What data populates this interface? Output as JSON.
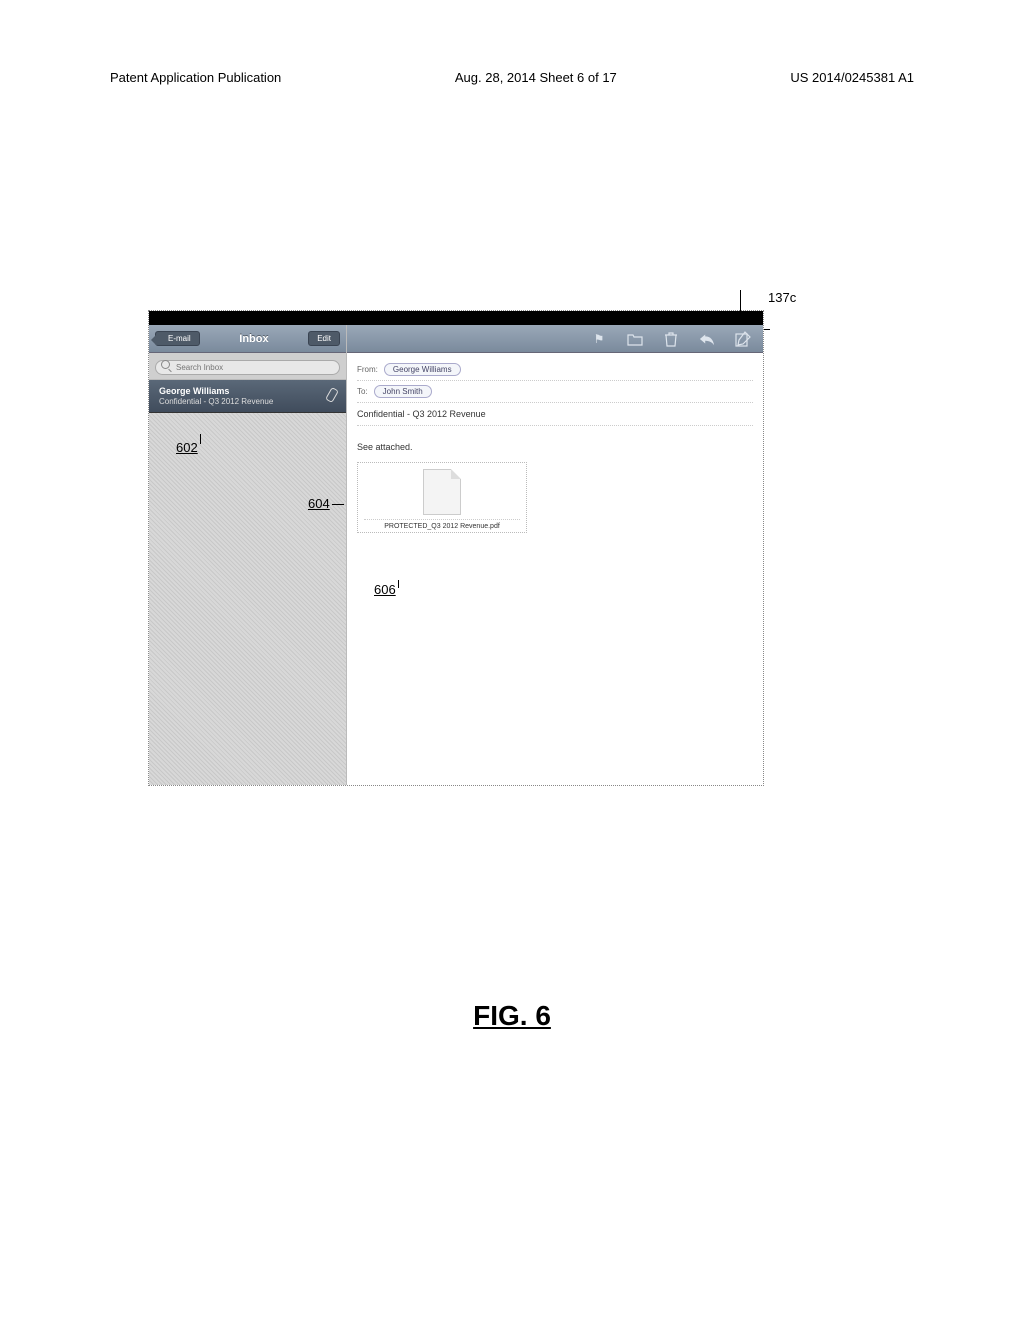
{
  "header": {
    "left": "Patent Application Publication",
    "center": "Aug. 28, 2014  Sheet 6 of 17",
    "right": "US 2014/0245381 A1"
  },
  "sidebar": {
    "back_label": "E-mail",
    "title": "Inbox",
    "edit_label": "Edit",
    "search_placeholder": "Search Inbox"
  },
  "message_list": {
    "items": [
      {
        "from": "George Williams",
        "subject": "Confidential - Q3 2012 Revenue"
      }
    ]
  },
  "message": {
    "from_label": "From:",
    "from_value": "George Williams",
    "to_label": "To:",
    "to_value": "John Smith",
    "subject": "Confidential - Q3 2012 Revenue",
    "body": "See attached.",
    "attachment_name": "PROTECTED_Q3 2012 Revenue.pdf"
  },
  "callouts": {
    "ref_137c": "137c",
    "ref_602": "602",
    "ref_604": "604",
    "ref_606": "606"
  },
  "figure_label": "FIG. 6"
}
